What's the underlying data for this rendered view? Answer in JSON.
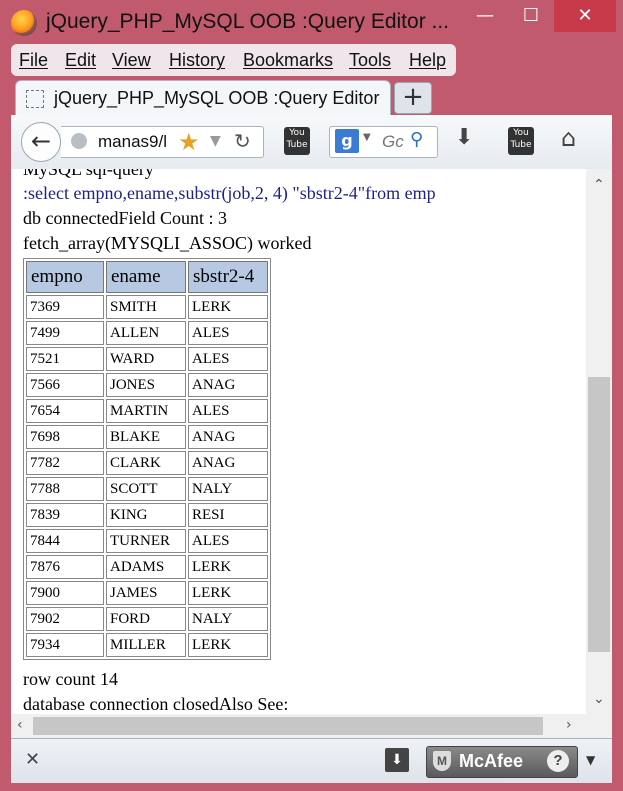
{
  "window": {
    "title": "jQuery_PHP_MySQL OOB :Query Editor ...",
    "minimize": "—",
    "maximize": "☐",
    "close": "✕"
  },
  "menu": [
    "File",
    "Edit",
    "View",
    "History",
    "Bookmarks",
    "Tools",
    "Help"
  ],
  "tab": {
    "title": "jQuery_PHP_MySQL OOB :Query Editor",
    "new_tab": "+"
  },
  "toolbar": {
    "back_icon": "back-arrow-icon",
    "url": "manas9/l",
    "search_engine": "g",
    "search_placeholder": "Gc",
    "icons": [
      "star-icon",
      "reload-icon",
      "youtube-icon",
      "google-search-icon",
      "search-icon",
      "download-icon",
      "youtube-icon",
      "home-icon"
    ]
  },
  "page": {
    "partial_line": "MySQL sql-query",
    "sql_line": ":select empno,ename,substr(job,2, 4) \"sbstr2-4\"from emp",
    "status_line": "db connectedField Count : 3",
    "fetch_line": "fetch_array(MYSQLI_ASSOC) worked",
    "table": {
      "headers": [
        "empno",
        "ename",
        "sbstr2-4"
      ],
      "rows": [
        [
          "7369",
          "SMITH",
          "LERK"
        ],
        [
          "7499",
          "ALLEN",
          "ALES"
        ],
        [
          "7521",
          "WARD",
          "ALES"
        ],
        [
          "7566",
          "JONES",
          "ANAG"
        ],
        [
          "7654",
          "MARTIN",
          "ALES"
        ],
        [
          "7698",
          "BLAKE",
          "ANAG"
        ],
        [
          "7782",
          "CLARK",
          "ANAG"
        ],
        [
          "7788",
          "SCOTT",
          "NALY"
        ],
        [
          "7839",
          "KING",
          "RESI"
        ],
        [
          "7844",
          "TURNER",
          "ALES"
        ],
        [
          "7876",
          "ADAMS",
          "LERK"
        ],
        [
          "7900",
          "JAMES",
          "LERK"
        ],
        [
          "7902",
          "FORD",
          "NALY"
        ],
        [
          "7934",
          "MILLER",
          "LERK"
        ]
      ]
    },
    "row_count": "row count 14",
    "closed_line": "database connection closedAlso See:"
  },
  "addon_bar": {
    "close": "✕",
    "mcafee": "McAfee",
    "help": "?"
  },
  "colors": {
    "window_frame": "#c25a6e",
    "sql_text": "#1f1f8c",
    "table_header": "#b7c9e2"
  }
}
